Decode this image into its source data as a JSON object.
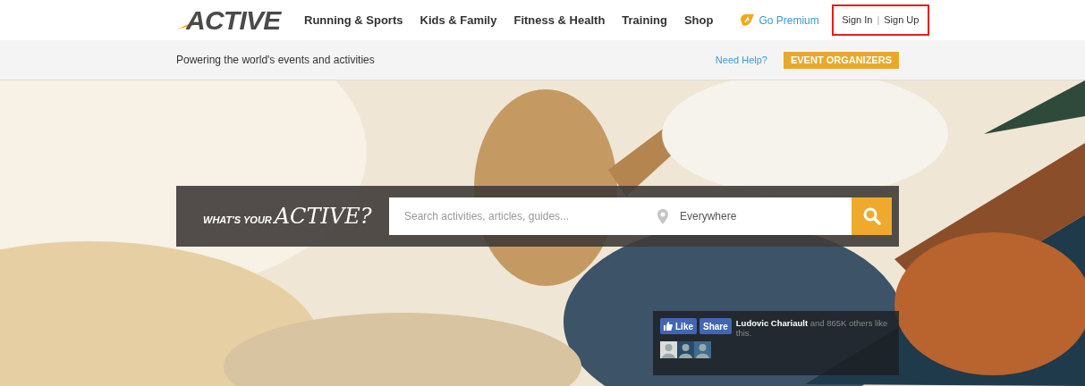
{
  "header": {
    "logo": "ACTIVE",
    "nav": [
      "Running & Sports",
      "Kids & Family",
      "Fitness & Health",
      "Training",
      "Shop"
    ],
    "premium": "Go Premium",
    "account": {
      "sign_in": "Sign In",
      "separator": "|",
      "sign_up": "Sign Up"
    }
  },
  "subheader": {
    "tagline": "Powering the world's events and activities",
    "help": "Need Help?",
    "organizers_button": "EVENT ORGANIZERS"
  },
  "hero": {
    "kind": "picture",
    "search": {
      "slogan_small": "WHAT'S YOUR",
      "slogan_big": "ACTIVE?",
      "placeholder": "Search activities, articles, guides...",
      "location": "Everywhere"
    },
    "facebook": {
      "like": "Like",
      "share": "Share",
      "text": "**Ludovic Chariault** and 865K others like this."
    }
  }
}
